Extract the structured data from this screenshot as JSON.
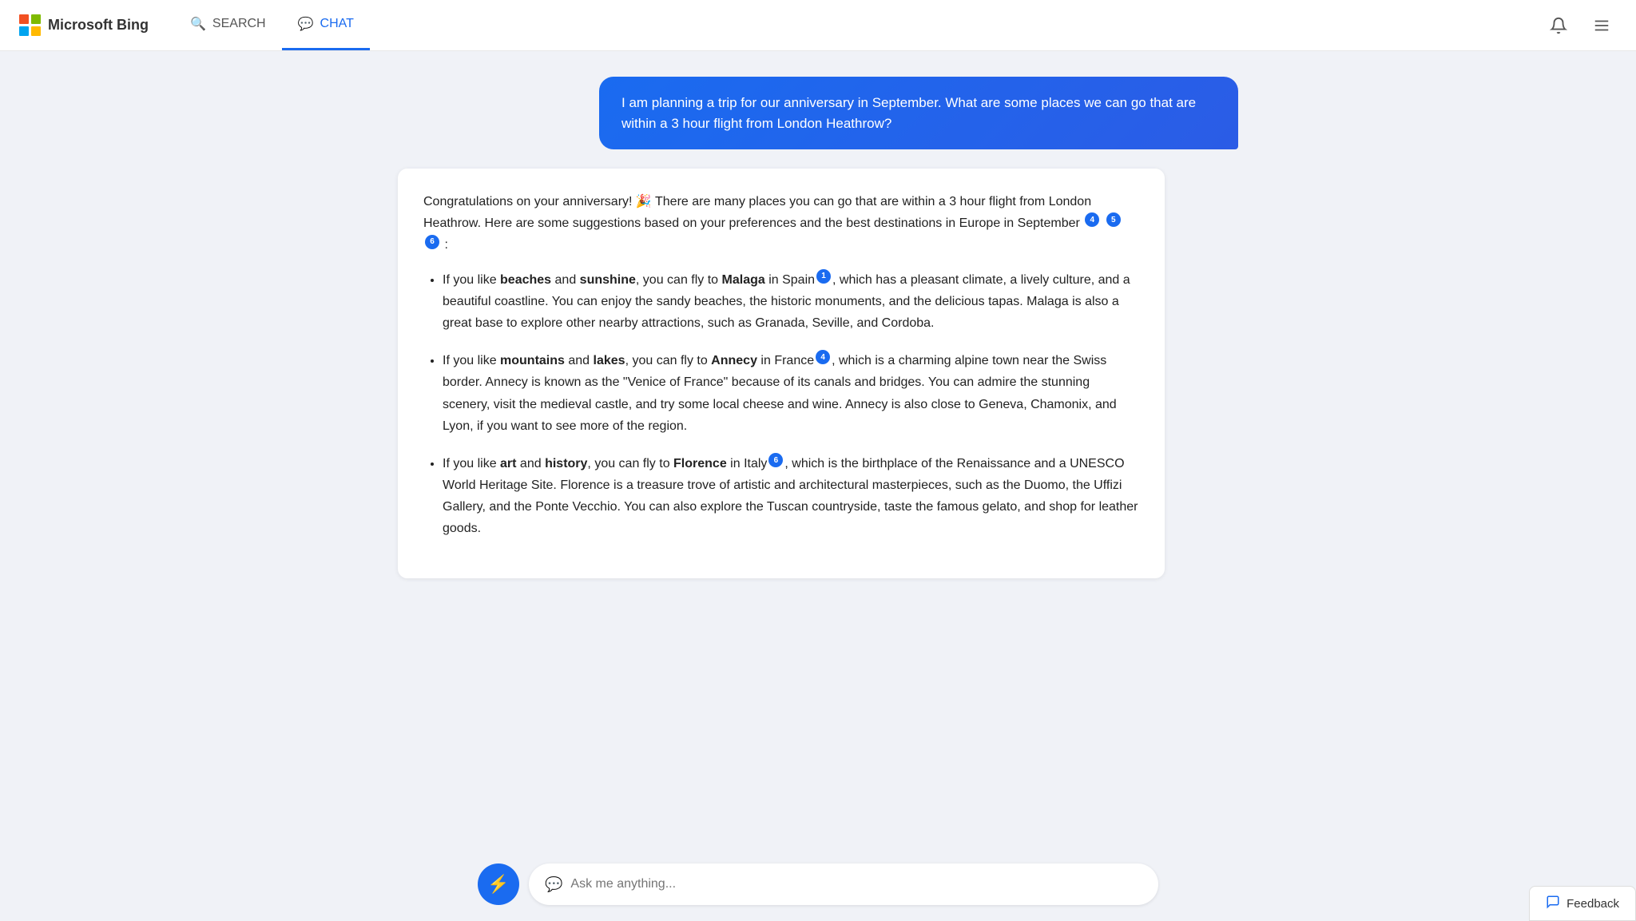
{
  "header": {
    "logo_text": "Microsoft Bing",
    "nav_search_label": "SEARCH",
    "nav_chat_label": "CHAT",
    "notification_label": "Notifications",
    "menu_label": "Menu"
  },
  "user_message": {
    "text": "I am planning a trip for our anniversary in September. What are some places we can go that are within a 3 hour flight from London Heathrow?"
  },
  "ai_response": {
    "intro": "Congratulations on your anniversary! 🎉 There are many places you can go that are within a 3 hour flight from London Heathrow. Here are some suggestions based on your preferences and the best destinations in Europe in September",
    "intro_citations": [
      "4",
      "5",
      "6"
    ],
    "items": [
      {
        "lead": "If you like ",
        "bold1": "beaches",
        "mid1": " and ",
        "bold2": "sunshine",
        "mid2": ", you can fly to ",
        "bold3": "Malaga",
        "mid3": " in Spain",
        "citation": "1",
        "rest": ", which has a pleasant climate, a lively culture, and a beautiful coastline. You can enjoy the sandy beaches, the historic monuments, and the delicious tapas. Malaga is also a great base to explore other nearby attractions, such as Granada, Seville, and Cordoba."
      },
      {
        "lead": "If you like ",
        "bold1": "mountains",
        "mid1": " and ",
        "bold2": "lakes",
        "mid2": ", you can fly to ",
        "bold3": "Annecy",
        "mid3": " in France",
        "citation": "4",
        "rest": ", which is a charming alpine town near the Swiss border. Annecy is known as the \"Venice of France\" because of its canals and bridges. You can admire the stunning scenery, visit the medieval castle, and try some local cheese and wine. Annecy is also close to Geneva, Chamonix, and Lyon, if you want to see more of the region."
      },
      {
        "lead": "If you like ",
        "bold1": "art",
        "mid1": " and ",
        "bold2": "history",
        "mid2": ", you can fly to ",
        "bold3": "Florence",
        "mid3": " in Italy",
        "citation": "6",
        "rest": ", which is the birthplace of the Renaissance and a UNESCO World Heritage Site. Florence is a treasure trove of artistic and architectural masterpieces, such as the Duomo, the Uffizi Gallery, and the Ponte Vecchio. You can also explore the Tuscan countryside, taste the famous gelato, and shop for leather goods."
      }
    ]
  },
  "input": {
    "placeholder": "Ask me anything..."
  },
  "feedback": {
    "label": "Feedback"
  }
}
